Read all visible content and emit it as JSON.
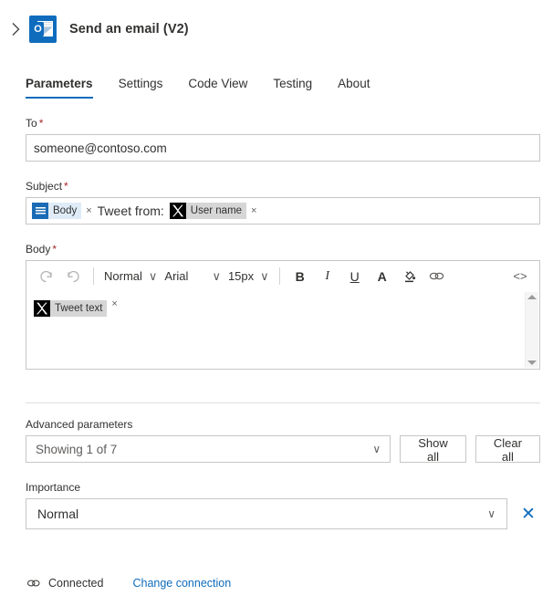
{
  "header": {
    "expand_icon": "chevron-right-icon",
    "app_icon": "outlook-icon",
    "app_icon_letter": "O",
    "title": "Send an email (V2)"
  },
  "tabs": [
    {
      "label": "Parameters",
      "active": true
    },
    {
      "label": "Settings",
      "active": false
    },
    {
      "label": "Code View",
      "active": false
    },
    {
      "label": "Testing",
      "active": false
    },
    {
      "label": "About",
      "active": false
    }
  ],
  "fields": {
    "to": {
      "label": "To",
      "required_marker": "*",
      "value": "someone@contoso.com"
    },
    "subject": {
      "label": "Subject",
      "required_marker": "*",
      "tokens": [
        {
          "icon": "body-list-icon",
          "label": "Body",
          "remove": "×",
          "style": "blue"
        }
      ],
      "static_text": "Tweet from:",
      "tokens_after": [
        {
          "icon": "x-twitter-icon",
          "label": "User name",
          "remove": "×",
          "style": "gray"
        }
      ]
    },
    "body": {
      "label": "Body",
      "required_marker": "*",
      "toolbar": {
        "undo": "↺",
        "redo": "↻",
        "style_dropdown": "Normal",
        "font_dropdown": "Arial",
        "size_dropdown": "15px",
        "caret": "∨",
        "bold": "B",
        "italic": "I",
        "underline": "U",
        "font_color": "A",
        "highlight": "highlight-icon",
        "link": "link-icon",
        "code_view": "<>"
      },
      "content_token": {
        "icon": "x-twitter-icon",
        "label": "Tweet text",
        "remove": "×"
      },
      "scroll_up": "scroll-up-arrow",
      "scroll_down": "scroll-down-arrow"
    },
    "advanced": {
      "label": "Advanced parameters",
      "select_value": "Showing 1 of 7",
      "caret": "∨",
      "show_all_label": "Show all",
      "clear_all_label": "Clear all"
    },
    "importance": {
      "label": "Importance",
      "value": "Normal",
      "caret": "∨",
      "clear_icon": "✕"
    }
  },
  "footer": {
    "connection_icon": "link-chain-icon",
    "status": "Connected",
    "change_link": "Change connection"
  },
  "colors": {
    "accent": "#0f6cbd",
    "required": "#a4262c",
    "token_blue_bg": "#dfecf8",
    "token_gray_bg": "#d6d6d6",
    "border": "#c8c6c4"
  }
}
